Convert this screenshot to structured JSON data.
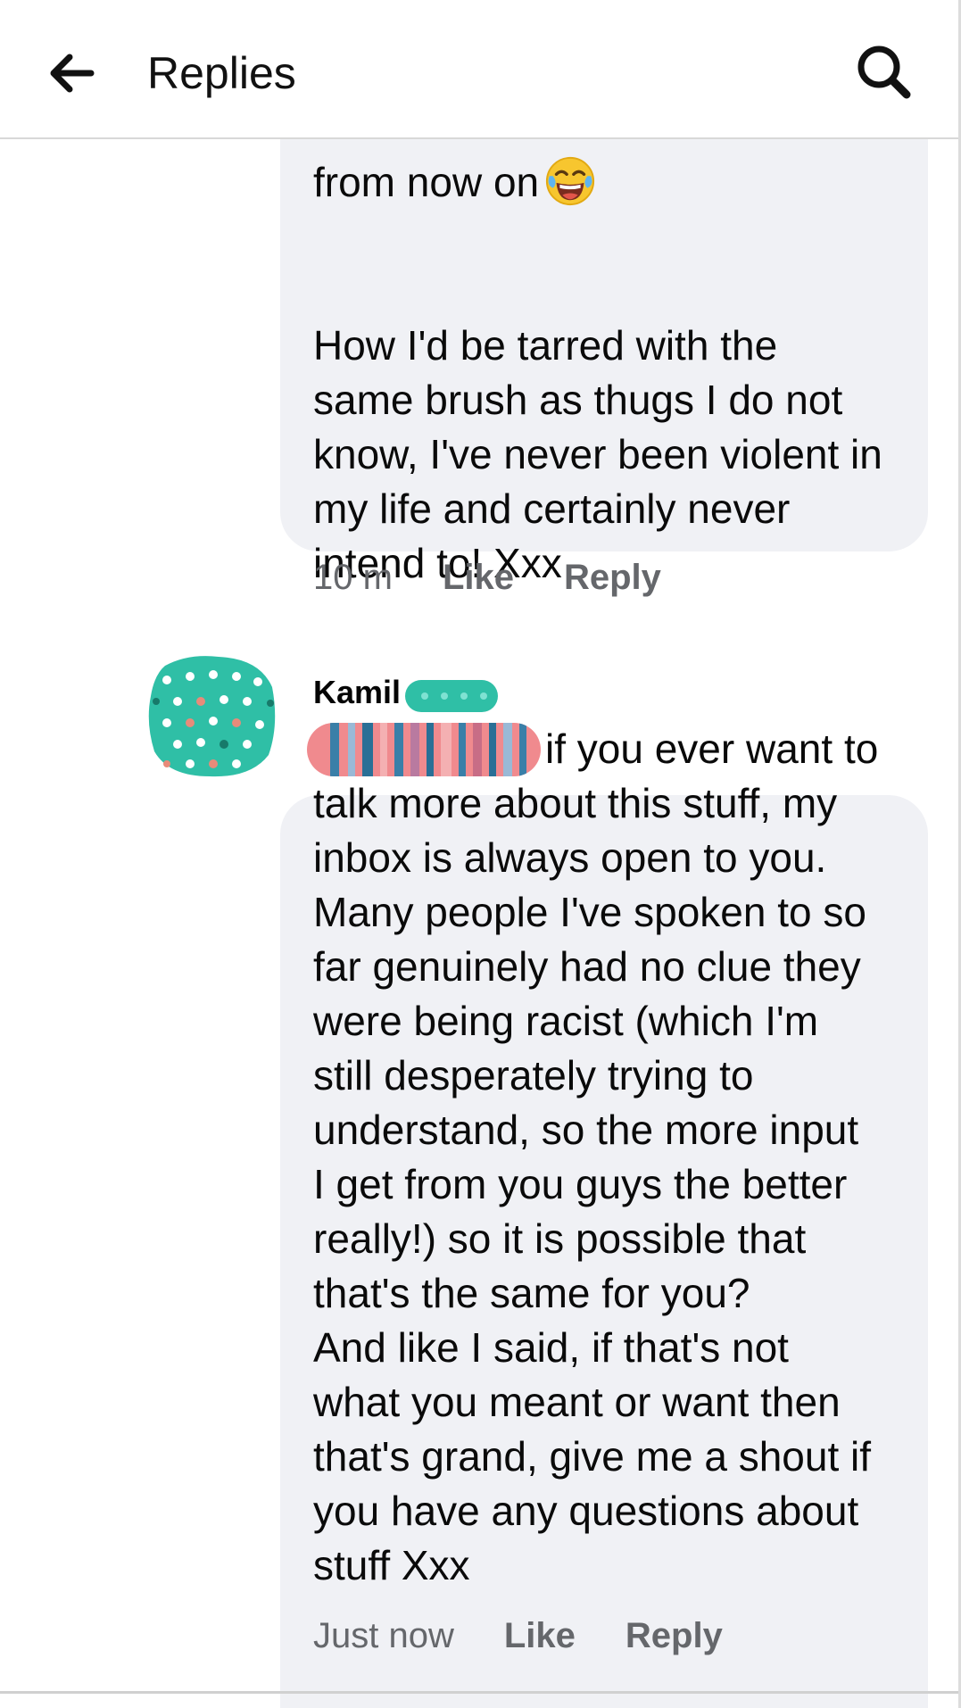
{
  "header": {
    "title": "Replies",
    "back_icon": "arrow-left-icon",
    "search_icon": "search-icon"
  },
  "comments": [
    {
      "text_line": "from now on",
      "emoji": "laughing-tears-emoji",
      "body": "How I'd be tarred with the\nsame brush as thugs I do not\nknow, I've never been violent in\nmy life and certainly never\nintend to! Xxx",
      "time": "10 m",
      "like": "Like",
      "reply": "Reply"
    },
    {
      "author": "Kamil",
      "first_line": "if you ever want to",
      "body": "talk more about this stuff, my\ninbox is always open to you.\nMany people I've spoken to so\nfar genuinely had no clue they\nwere being racist (which I'm\nstill desperately trying to\nunderstand, so the more input\nI get from you guys the better\nreally!) so it is possible that\nthat's the same for you?\nAnd like I said, if that's not\nwhat you meant or want then\nthat's grand, give me a shout if\nyou have any questions about\nstuff Xxx",
      "time": "Just now",
      "like": "Like",
      "reply": "Reply"
    }
  ],
  "colors": {
    "bubble": "#f0f1f5",
    "meta_text": "#65676b",
    "avatar_teal": "#2fbfa6"
  }
}
